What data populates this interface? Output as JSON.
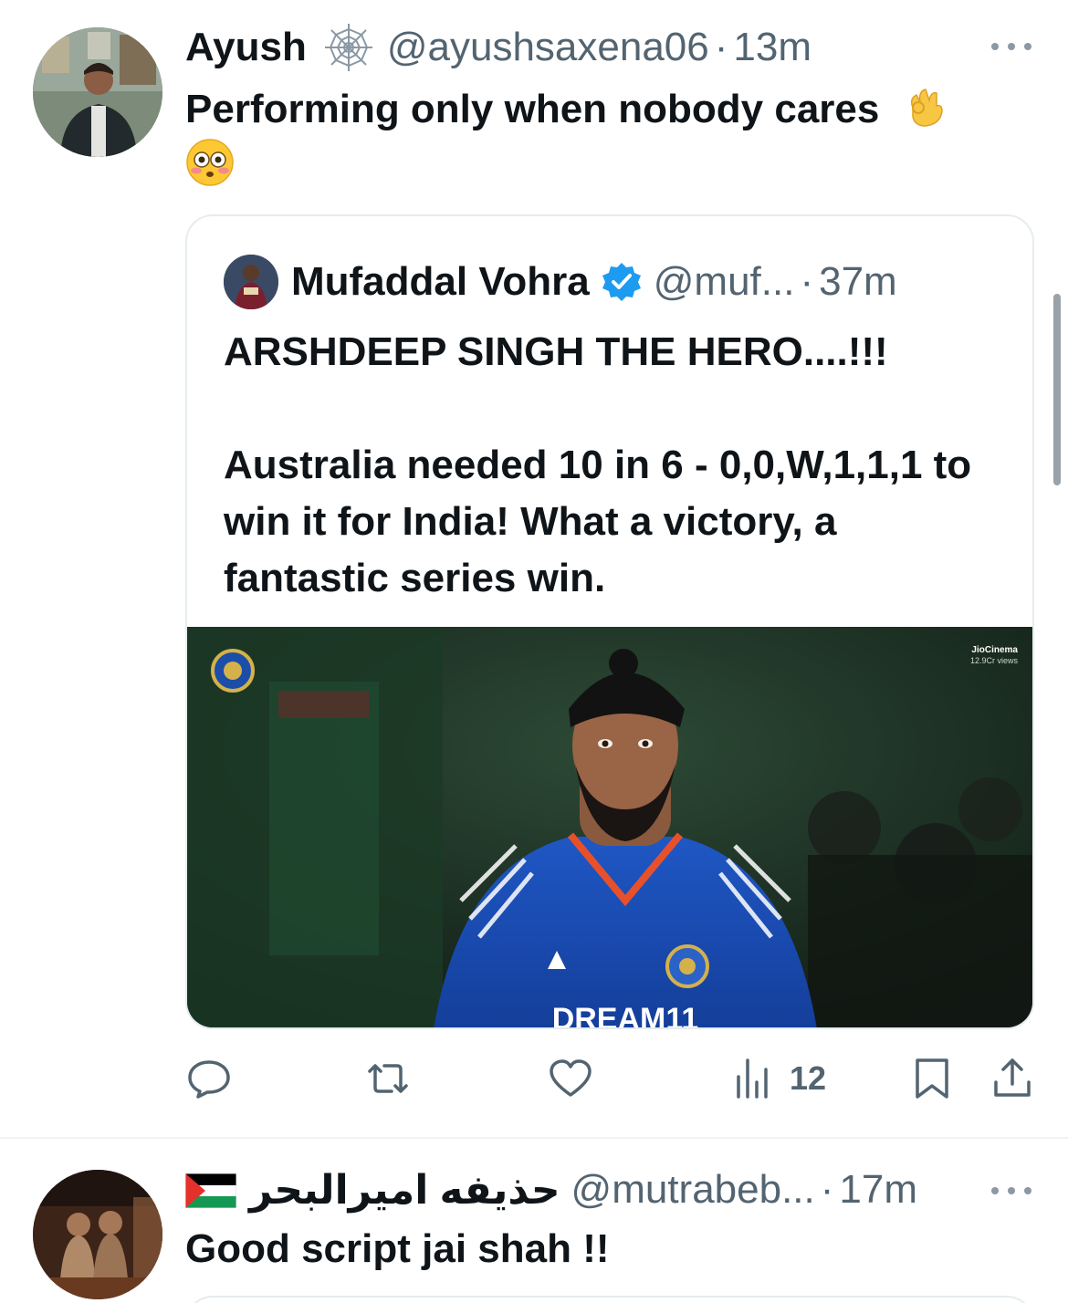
{
  "tweet1": {
    "author_name": "Ayush",
    "author_handle": "@ayushsaxena06",
    "separator": "·",
    "time": "13m",
    "text": "Performing only when nobody cares",
    "emojis": [
      "ok-hand-emoji",
      "flushed-face-emoji"
    ],
    "quote": {
      "author_name": "Mufaddal Vohra",
      "author_handle": "@muf...",
      "separator": "·",
      "time": "37m",
      "line1": "ARSHDEEP SINGH THE HERO....!!!",
      "line2": "Australia needed 10 in 6 - 0,0,W,1,1,1 to win it for India! What a victory, a fantastic series win.",
      "media": {
        "watermark_brand": "JioCinema",
        "watermark_views": "12.9Cr views",
        "jersey_text": "DREAM11"
      }
    },
    "actions": {
      "views": "12"
    }
  },
  "tweet2": {
    "author_name": "حذيفه اميرالبحر",
    "author_handle": "@mutrabeb...",
    "separator": "·",
    "time": "17m",
    "text": "Good script jai shah !!"
  },
  "colors": {
    "text_primary": "#0f1419",
    "text_secondary": "#536471",
    "verified_blue": "#1d9bf0",
    "border": "#e6ecf0"
  }
}
